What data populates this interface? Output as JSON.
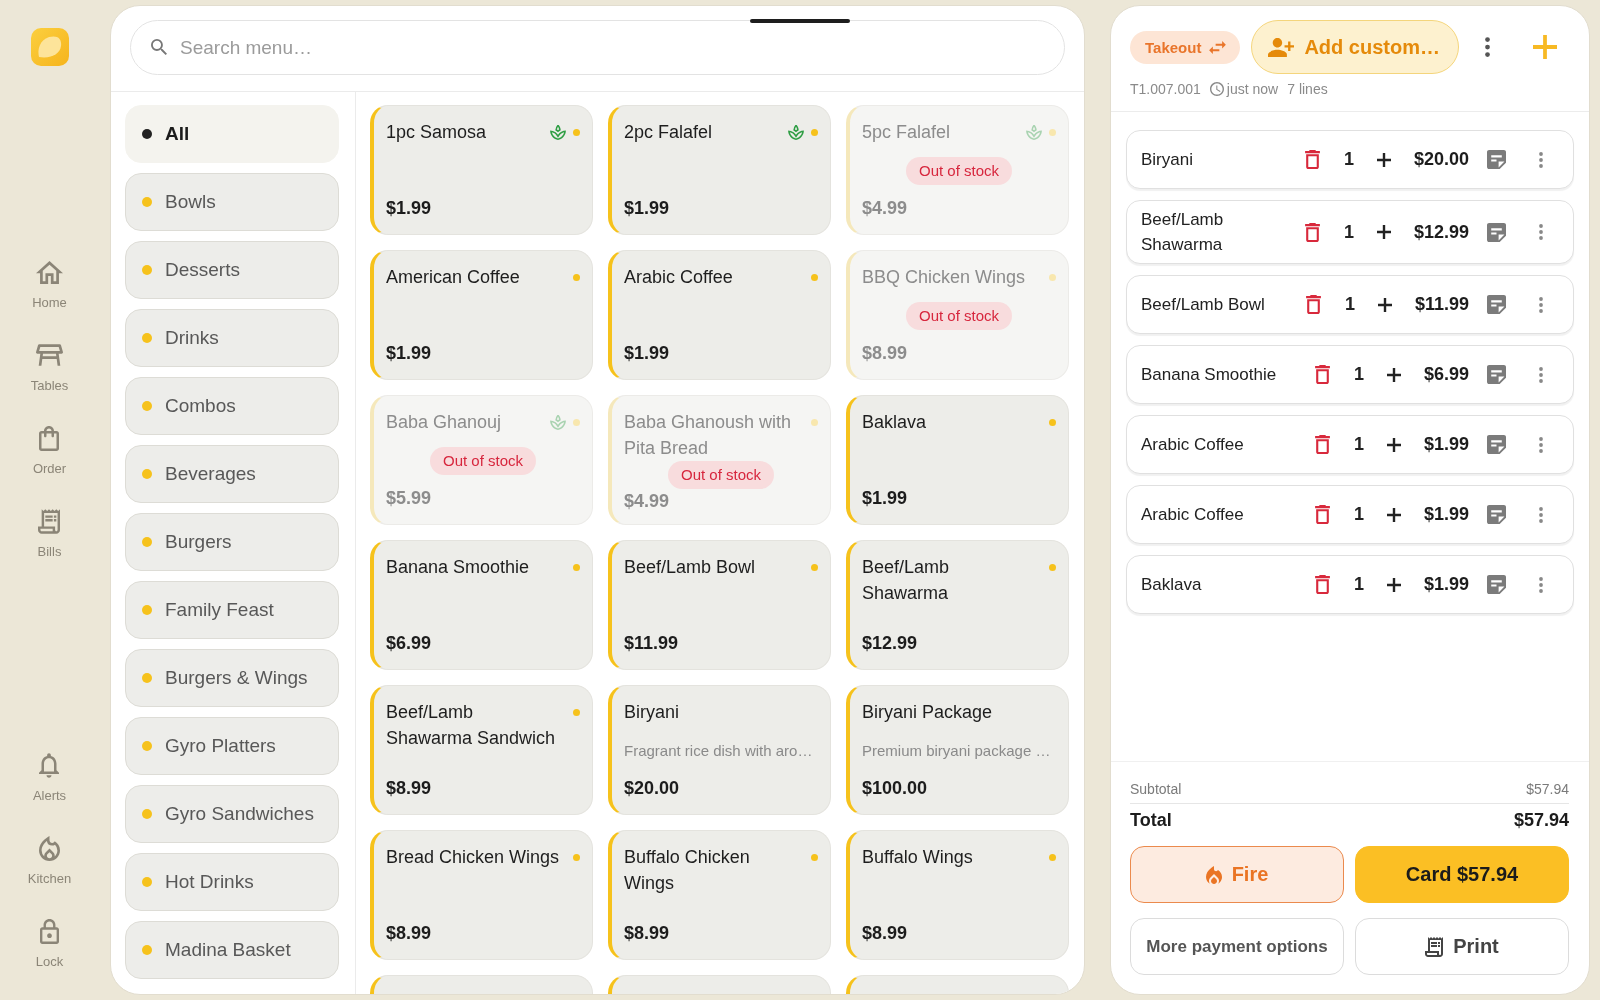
{
  "nav": {
    "items": [
      {
        "kind": "home",
        "label": "Home"
      },
      {
        "kind": "tables",
        "label": "Tables"
      },
      {
        "kind": "order",
        "label": "Order"
      },
      {
        "kind": "bills",
        "label": "Bills"
      }
    ],
    "bottom_items": [
      {
        "kind": "alerts",
        "label": "Alerts"
      },
      {
        "kind": "kitchen",
        "label": "Kitchen"
      },
      {
        "kind": "lock",
        "label": "Lock"
      }
    ]
  },
  "menu": {
    "search": {
      "placeholder": "Search menu…"
    },
    "categories": [
      {
        "label": "All",
        "selected": true
      },
      {
        "label": "Bowls",
        "selected": false
      },
      {
        "label": "Desserts",
        "selected": false
      },
      {
        "label": "Drinks",
        "selected": false
      },
      {
        "label": "Combos",
        "selected": false
      },
      {
        "label": "Beverages",
        "selected": false
      },
      {
        "label": "Burgers",
        "selected": false
      },
      {
        "label": "Family Feast",
        "selected": false
      },
      {
        "label": "Burgers & Wings",
        "selected": false
      },
      {
        "label": "Gyro Platters",
        "selected": false
      },
      {
        "label": "Gyro Sandwiches",
        "selected": false
      },
      {
        "label": "Hot Drinks",
        "selected": false
      },
      {
        "label": "Madina Basket",
        "selected": false
      }
    ],
    "items": [
      {
        "name": "1pc Samosa",
        "price": "$1.99",
        "available": true,
        "veg": true,
        "dot": true
      },
      {
        "name": "2pc Falafel",
        "price": "$1.99",
        "available": true,
        "veg": true,
        "dot": true
      },
      {
        "name": "5pc Falafel",
        "price": "$4.99",
        "available": false,
        "stock_label": "Out of stock",
        "veg": true,
        "dot": true
      },
      {
        "name": "American Coffee",
        "price": "$1.99",
        "available": true,
        "veg": false,
        "dot": true
      },
      {
        "name": "Arabic Coffee",
        "price": "$1.99",
        "available": true,
        "veg": false,
        "dot": true
      },
      {
        "name": "BBQ Chicken Wings",
        "price": "$8.99",
        "available": false,
        "stock_label": "Out of stock",
        "veg": false,
        "dot": true
      },
      {
        "name": "Baba Ghanouj",
        "price": "$5.99",
        "available": false,
        "stock_label": "Out of stock",
        "veg": true,
        "dot": true
      },
      {
        "name": "Baba Ghanoush with Pita Bread",
        "price": "$4.99",
        "available": false,
        "stock_label": "Out of stock",
        "veg": false,
        "dot": true
      },
      {
        "name": "Baklava",
        "price": "$1.99",
        "available": true,
        "veg": false,
        "dot": true
      },
      {
        "name": "Banana Smoothie",
        "price": "$6.99",
        "available": true,
        "veg": false,
        "dot": true
      },
      {
        "name": "Beef/Lamb Bowl",
        "price": "$11.99",
        "available": true,
        "veg": false,
        "dot": true
      },
      {
        "name": "Beef/Lamb Shawarma",
        "price": "$12.99",
        "available": true,
        "veg": false,
        "dot": true
      },
      {
        "name": "Beef/Lamb Shawarma Sandwich",
        "price": "$8.99",
        "available": true,
        "veg": false,
        "dot": true
      },
      {
        "name": "Biryani",
        "description": "Fragrant rice dish with aro…",
        "price": "$20.00",
        "available": true,
        "veg": false,
        "dot": false
      },
      {
        "name": "Biryani Package",
        "description": "Premium biryani package …",
        "price": "$100.00",
        "available": true,
        "veg": false,
        "dot": false
      },
      {
        "name": "Bread Chicken Wings",
        "price": "$8.99",
        "available": true,
        "veg": false,
        "dot": true
      },
      {
        "name": "Buffalo Chicken Wings",
        "price": "$8.99",
        "available": true,
        "veg": false,
        "dot": true
      },
      {
        "name": "Buffalo Wings",
        "price": "$8.99",
        "available": true,
        "veg": false,
        "dot": true
      },
      {
        "available": true
      },
      {
        "available": true
      },
      {
        "available": true
      }
    ]
  },
  "order": {
    "type": "Takeout",
    "customer_button": "Add custom…",
    "ticket": "T1.007.001",
    "time": "just now",
    "line_count": "7 lines",
    "lines": [
      {
        "name": "Biryani",
        "qty": "1",
        "price": "$20.00"
      },
      {
        "name": "Beef/Lamb Shawarma",
        "qty": "1",
        "price": "$12.99"
      },
      {
        "name": "Beef/Lamb Bowl",
        "qty": "1",
        "price": "$11.99"
      },
      {
        "name": "Banana Smoothie",
        "qty": "1",
        "price": "$6.99"
      },
      {
        "name": "Arabic Coffee",
        "qty": "1",
        "price": "$1.99"
      },
      {
        "name": "Arabic Coffee",
        "qty": "1",
        "price": "$1.99"
      },
      {
        "name": "Baklava",
        "qty": "1",
        "price": "$1.99"
      }
    ],
    "subtotal": {
      "label": "Subtotal",
      "value": "$57.94"
    },
    "total": {
      "label": "Total",
      "value": "$57.94"
    },
    "actions": [
      {
        "kind": "fire",
        "label": "Fire"
      },
      {
        "kind": "pay",
        "label": "Card $57.94"
      },
      {
        "kind": "more",
        "label": "More payment options"
      },
      {
        "kind": "print",
        "label": "Print"
      }
    ]
  }
}
